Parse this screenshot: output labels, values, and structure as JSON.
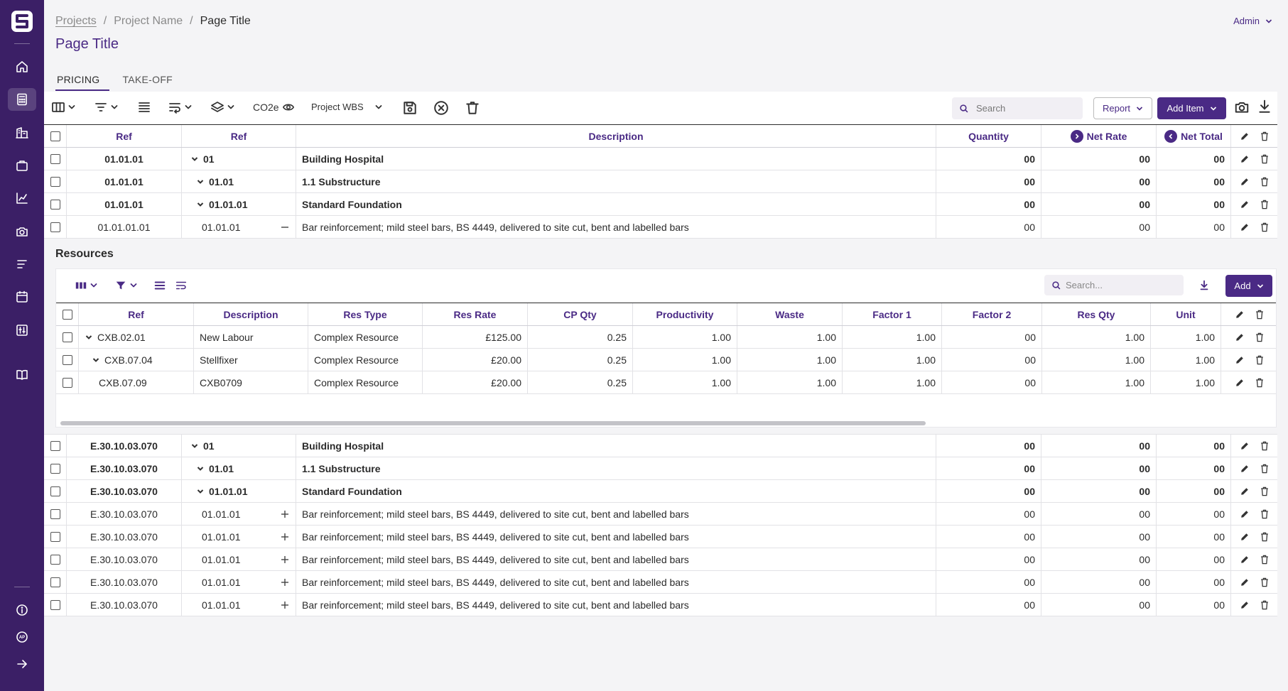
{
  "app": {
    "colors": {
      "brand": "#3b1f66",
      "accent": "#4a2a85",
      "background": "#f4f4f6"
    }
  },
  "sidebar": {
    "logo_icon": "app-logo-icon",
    "items": [
      {
        "name": "home",
        "icon": "home-icon",
        "active": false
      },
      {
        "name": "pricing",
        "icon": "calculator-icon",
        "active": true
      },
      {
        "name": "buildings",
        "icon": "building-icon",
        "active": false
      },
      {
        "name": "briefcase",
        "icon": "briefcase-icon",
        "active": false
      },
      {
        "name": "analytics",
        "icon": "chart-line-icon",
        "active": false
      },
      {
        "name": "camera",
        "icon": "camera-icon",
        "active": false
      },
      {
        "name": "list",
        "icon": "list-icon",
        "active": false
      },
      {
        "name": "calendar",
        "icon": "calendar-icon",
        "active": false
      },
      {
        "name": "settings-panel",
        "icon": "sliders-icon",
        "active": false
      },
      {
        "name": "library",
        "icon": "book-icon",
        "active": false
      }
    ],
    "bottom": [
      {
        "name": "info",
        "icon": "info-icon"
      },
      {
        "name": "profile",
        "icon": "avatar-ap-icon",
        "initials": "AP"
      },
      {
        "name": "expand",
        "icon": "arrow-right-icon"
      }
    ]
  },
  "header": {
    "breadcrumb": [
      "Projects",
      "Project Name",
      "Page Title"
    ],
    "separator": "/",
    "title": "Page Title",
    "user": "Admin"
  },
  "tabs": [
    "PRICING",
    "TAKE-OFF"
  ],
  "toolbar": {
    "co2_label": "CO2e",
    "wbs_label": "Project WBS",
    "search_placeholder": "Search",
    "report_label": "Report",
    "add_item_label": "Add Item"
  },
  "main_table": {
    "columns": [
      "Ref",
      "Ref",
      "Description",
      "Quantity",
      "Net Rate",
      "Net Total"
    ],
    "rows_top": [
      {
        "ref1": "01.01.01",
        "ref2": "01",
        "level": 0,
        "kind": "group",
        "desc": "Building Hospital",
        "qty": "00",
        "rate": "00",
        "total": "00"
      },
      {
        "ref1": "01.01.01",
        "ref2": "01.01",
        "level": 1,
        "kind": "group",
        "desc": "1.1 Substructure",
        "qty": "00",
        "rate": "00",
        "total": "00"
      },
      {
        "ref1": "01.01.01",
        "ref2": "01.01.01",
        "level": 1,
        "kind": "group",
        "desc": "Standard Foundation",
        "qty": "00",
        "rate": "00",
        "total": "00"
      },
      {
        "ref1": "01.01.01.01",
        "ref2": "01.01.01",
        "level": 2,
        "kind": "item-open",
        "desc": "Bar reinforcement; mild steel bars, BS 4449, delivered to site cut, bent and labelled bars",
        "qty": "00",
        "rate": "00",
        "total": "00"
      }
    ],
    "rows_bottom": [
      {
        "ref1": "E.30.10.03.070",
        "ref2": "01",
        "level": 0,
        "kind": "group",
        "desc": "Building Hospital",
        "qty": "00",
        "rate": "00",
        "total": "00"
      },
      {
        "ref1": "E.30.10.03.070",
        "ref2": "01.01",
        "level": 1,
        "kind": "group",
        "desc": "1.1 Substructure",
        "qty": "00",
        "rate": "00",
        "total": "00"
      },
      {
        "ref1": "E.30.10.03.070",
        "ref2": "01.01.01",
        "level": 1,
        "kind": "group",
        "desc": "Standard Foundation",
        "qty": "00",
        "rate": "00",
        "total": "00"
      },
      {
        "ref1": "E.30.10.03.070",
        "ref2": "01.01.01",
        "level": 2,
        "kind": "item",
        "desc": "Bar reinforcement; mild steel bars, BS 4449, delivered to site cut, bent and labelled bars",
        "qty": "00",
        "rate": "00",
        "total": "00"
      },
      {
        "ref1": "E.30.10.03.070",
        "ref2": "01.01.01",
        "level": 2,
        "kind": "item",
        "desc": "Bar reinforcement; mild steel bars, BS 4449, delivered to site cut, bent and labelled bars",
        "qty": "00",
        "rate": "00",
        "total": "00"
      },
      {
        "ref1": "E.30.10.03.070",
        "ref2": "01.01.01",
        "level": 2,
        "kind": "item",
        "desc": "Bar reinforcement; mild steel bars, BS 4449, delivered to site cut, bent and labelled bars",
        "qty": "00",
        "rate": "00",
        "total": "00"
      },
      {
        "ref1": "E.30.10.03.070",
        "ref2": "01.01.01",
        "level": 2,
        "kind": "item",
        "desc": "Bar reinforcement; mild steel bars, BS 4449, delivered to site cut, bent and labelled bars",
        "qty": "00",
        "rate": "00",
        "total": "00"
      },
      {
        "ref1": "E.30.10.03.070",
        "ref2": "01.01.01",
        "level": 2,
        "kind": "item",
        "desc": "Bar reinforcement; mild steel bars, BS 4449, delivered to site cut, bent and labelled bars",
        "qty": "00",
        "rate": "00",
        "total": "00"
      }
    ]
  },
  "resources": {
    "title": "Resources",
    "search_placeholder": "Search...",
    "add_label": "Add",
    "columns": [
      "Ref",
      "Description",
      "Res Type",
      "Res Rate",
      "CP Qty",
      "Productivity",
      "Waste",
      "Factor 1",
      "Factor 2",
      "Res Qty",
      "Unit"
    ],
    "rows": [
      {
        "ref": "CXB.02.01",
        "expand": "open",
        "indent": 0,
        "desc": "New Labour",
        "type": "Complex Resource",
        "rate": "£125.00",
        "cpqty": "0.25",
        "prod": "1.00",
        "waste": "1.00",
        "f1": "1.00",
        "f2": "00",
        "resqty": "1.00",
        "unit": "1.00"
      },
      {
        "ref": "CXB.07.04",
        "expand": "open",
        "indent": 1,
        "desc": "Stellfixer",
        "type": "Complex Resource",
        "rate": "£20.00",
        "cpqty": "0.25",
        "prod": "1.00",
        "waste": "1.00",
        "f1": "1.00",
        "f2": "00",
        "resqty": "1.00",
        "unit": "1.00"
      },
      {
        "ref": "CXB.07.09",
        "expand": "none",
        "indent": 2,
        "desc": "CXB0709",
        "type": "Complex Resource",
        "rate": "£20.00",
        "cpqty": "0.25",
        "prod": "1.00",
        "waste": "1.00",
        "f1": "1.00",
        "f2": "00",
        "resqty": "1.00",
        "unit": "1.00"
      }
    ]
  }
}
